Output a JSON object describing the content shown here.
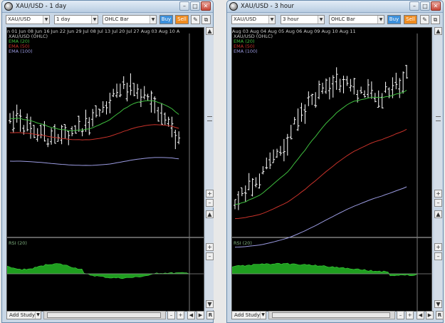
{
  "windows": [
    {
      "title": "XAU/USD - 1 day",
      "symbol": "XAU/USD",
      "timeframe": "1 day",
      "chart_style": "OHLC Bar",
      "buy_label": "Buy",
      "sell_label": "Sell",
      "legend": [
        "XAU/USD (OHLC)",
        "EMA (20)",
        "EMA (50)",
        "EMA (100)"
      ],
      "date_labels": "n 01 Jun 08  Jun 16  Jun 22  Jun 29  Jul 08   Jul 13   Jul 20   Jul 27   Aug 03  Aug 10  A",
      "rsi_label": "RSI (20)",
      "add_study_label": "Add Study",
      "r_label": "R"
    },
    {
      "title": "XAU/USD - 3 hour",
      "symbol": "XAU/USD",
      "timeframe": "3 hour",
      "chart_style": "OHLC Bar",
      "buy_label": "Buy",
      "sell_label": "Sell",
      "legend": [
        "XAU/USD (OHLC)",
        "EMA (20)",
        "EMA (50)",
        "EMA (100)"
      ],
      "date_labels": " Aug 03     Aug 04      Aug 05      Aug 06      Aug 09      Aug 10      Aug 11",
      "rsi_label": "RSI (20)",
      "add_study_label": "Add Study",
      "r_label": "R"
    }
  ],
  "colors": {
    "background": "#000000",
    "ohlc_bars": "#ffffff",
    "ema20": "#3fbf3f",
    "ema50": "#c8322a",
    "ema100": "#9a9ae0",
    "rsi_fill": "#1f9e1f",
    "buy": "#3b8fdb",
    "sell": "#ee8b20"
  },
  "icons": {
    "app": "globe-icon",
    "minimize": "minimize-icon",
    "maximize": "maximize-icon",
    "close": "close-icon",
    "pencil": "pencil-icon",
    "popout": "popout-icon",
    "dropdown": "chevron-down-icon"
  }
}
